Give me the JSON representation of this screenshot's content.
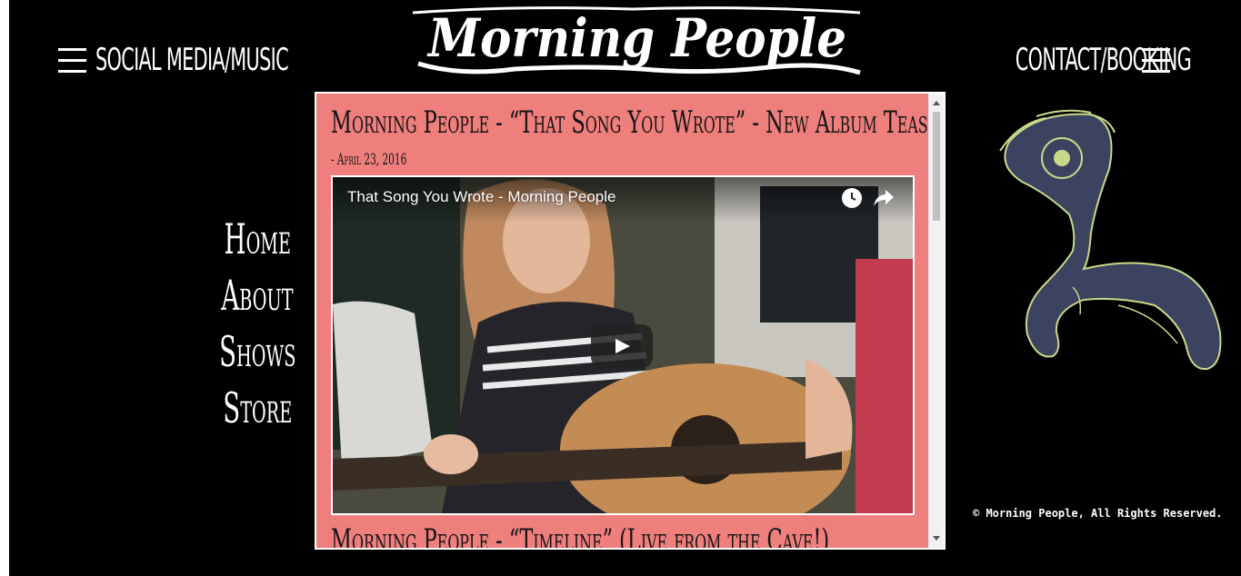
{
  "header": {
    "logo_text": "Morning People",
    "menu_left_label": "SOCIAL MEDIA/MUSIC",
    "menu_right_label": "CONTACT/BOOKING"
  },
  "sidenav": {
    "items": [
      {
        "label": "Home"
      },
      {
        "label": "About"
      },
      {
        "label": "Shows"
      },
      {
        "label": "Store"
      }
    ]
  },
  "feed": {
    "posts": [
      {
        "title": "Morning People - “That Song You Wrote” - New Album Teaser!",
        "date": "- April 23, 2016",
        "video_title": "That Song You Wrote - Morning People"
      },
      {
        "title": "Morning People - “Timeline” (Live from the Cave!)"
      }
    ]
  },
  "footer": {
    "copyright": "© Morning People, All Rights Reserved."
  },
  "colors": {
    "background": "#000000",
    "feed_background": "#ef7f7d",
    "text": "#ffffff",
    "illustration_fill": "#3b4360",
    "illustration_line": "#c9d98a"
  },
  "icons": [
    "menu-icon",
    "watch-later-icon",
    "share-icon",
    "play-icon"
  ]
}
